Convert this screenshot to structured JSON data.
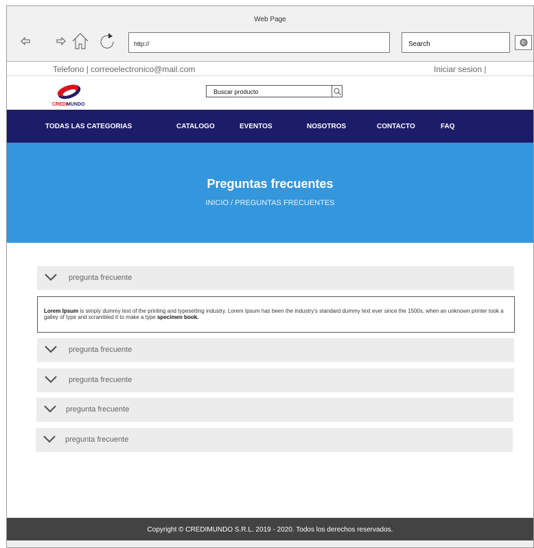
{
  "browser": {
    "window_title": "Web Page",
    "url_value": "http://",
    "search_value": "Search"
  },
  "topbar": {
    "contact": "Telefono | correoelectronico@mail.com",
    "login": "Iniciar sesion |"
  },
  "logo": {
    "text": "CREDIMUNDO",
    "colors": {
      "red": "#d9141c",
      "navy": "#1c1c69"
    }
  },
  "site_search": {
    "value": "Buscar producto"
  },
  "nav": {
    "items": [
      "TODAS LAS CATEGORIAS",
      "CATALOGO",
      "EVENTOS",
      "NOSOTROS",
      "CONTACTO",
      "FAQ"
    ]
  },
  "hero": {
    "title": "Preguntas frecuentes",
    "breadcrumb": "INICIO / PREGUNTAS FRECUENTES"
  },
  "faq": {
    "items": [
      "pregunta frecuente",
      "pregunta frecuente",
      "pregunta frecuente",
      "pregunta frecuente",
      "pregunta frecuente"
    ],
    "answer": {
      "strong_start": "Lorem Ipsum",
      "text": " is simply dummy text of the printing and typesetting industry. Lorem Ipsum has been the industry's standard dummy text ever since the 1500s, when an unknown printer took a galley of type and scrambled it to make a type ",
      "strong_end": "specimen book."
    }
  },
  "footer": {
    "text": "Copyright © CREDIMUNDO S.R.L. 2019 - 2020. Todos los derechos reservados."
  },
  "colors": {
    "nav_bg": "#1c1c69",
    "hero_bg": "#3496dc",
    "footer_bg": "#434343",
    "faq_row_bg": "#ececec"
  },
  "icons": [
    "back-arrow-icon",
    "forward-arrow-icon",
    "home-icon",
    "reload-icon",
    "globe-icon",
    "magnifier-icon",
    "chevron-down-icon"
  ]
}
